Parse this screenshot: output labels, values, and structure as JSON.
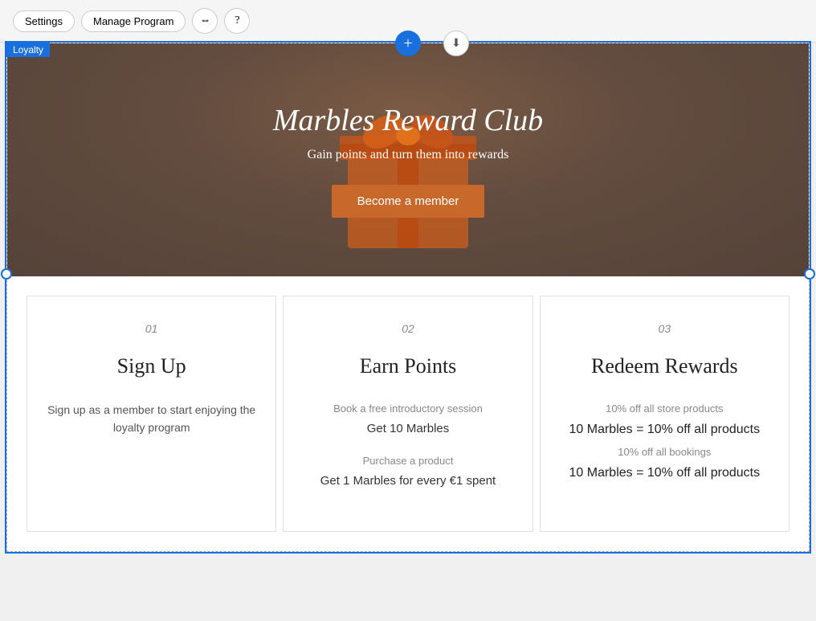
{
  "toolbar": {
    "settings_label": "Settings",
    "manage_program_label": "Manage Program",
    "switch_icon": "⇔",
    "help_icon": "?"
  },
  "loyalty_label": "Loyalty",
  "hero": {
    "title": "Marbles Reward Club",
    "subtitle": "Gain points and turn them into rewards",
    "cta_label": "Become a member"
  },
  "cards": [
    {
      "number": "01",
      "title": "Sign Up",
      "description": "Sign up as a member to start enjoying the loyalty program"
    },
    {
      "number": "02",
      "title": "Earn Points",
      "item1_label": "Book a free introductory session",
      "item1_value": "Get 10 Marbles",
      "item2_label": "Purchase a product",
      "item2_value": "Get 1 Marbles for every €1 spent"
    },
    {
      "number": "03",
      "title": "Redeem Rewards",
      "reward1_label": "10% off all store products",
      "reward1_value": "10 Marbles = 10% off all products",
      "reward2_label": "10% off all bookings",
      "reward2_value": "10 Marbles = 10% off all products"
    }
  ],
  "add_btn_label": "+",
  "download_icon": "⬇"
}
